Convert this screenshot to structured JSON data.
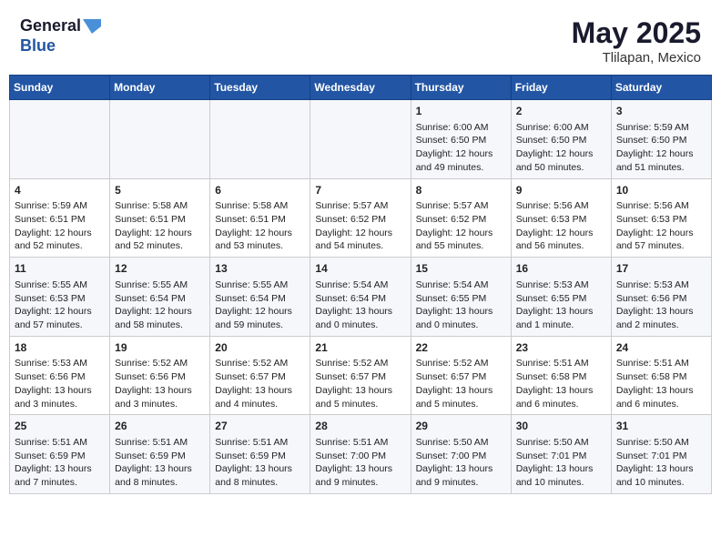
{
  "logo": {
    "line1": "General",
    "line2": "Blue"
  },
  "title": "May 2025",
  "location": "Tlilapan, Mexico",
  "weekdays": [
    "Sunday",
    "Monday",
    "Tuesday",
    "Wednesday",
    "Thursday",
    "Friday",
    "Saturday"
  ],
  "weeks": [
    [
      {
        "day": "",
        "info": ""
      },
      {
        "day": "",
        "info": ""
      },
      {
        "day": "",
        "info": ""
      },
      {
        "day": "",
        "info": ""
      },
      {
        "day": "1",
        "info": "Sunrise: 6:00 AM\nSunset: 6:50 PM\nDaylight: 12 hours\nand 49 minutes."
      },
      {
        "day": "2",
        "info": "Sunrise: 6:00 AM\nSunset: 6:50 PM\nDaylight: 12 hours\nand 50 minutes."
      },
      {
        "day": "3",
        "info": "Sunrise: 5:59 AM\nSunset: 6:50 PM\nDaylight: 12 hours\nand 51 minutes."
      }
    ],
    [
      {
        "day": "4",
        "info": "Sunrise: 5:59 AM\nSunset: 6:51 PM\nDaylight: 12 hours\nand 52 minutes."
      },
      {
        "day": "5",
        "info": "Sunrise: 5:58 AM\nSunset: 6:51 PM\nDaylight: 12 hours\nand 52 minutes."
      },
      {
        "day": "6",
        "info": "Sunrise: 5:58 AM\nSunset: 6:51 PM\nDaylight: 12 hours\nand 53 minutes."
      },
      {
        "day": "7",
        "info": "Sunrise: 5:57 AM\nSunset: 6:52 PM\nDaylight: 12 hours\nand 54 minutes."
      },
      {
        "day": "8",
        "info": "Sunrise: 5:57 AM\nSunset: 6:52 PM\nDaylight: 12 hours\nand 55 minutes."
      },
      {
        "day": "9",
        "info": "Sunrise: 5:56 AM\nSunset: 6:53 PM\nDaylight: 12 hours\nand 56 minutes."
      },
      {
        "day": "10",
        "info": "Sunrise: 5:56 AM\nSunset: 6:53 PM\nDaylight: 12 hours\nand 57 minutes."
      }
    ],
    [
      {
        "day": "11",
        "info": "Sunrise: 5:55 AM\nSunset: 6:53 PM\nDaylight: 12 hours\nand 57 minutes."
      },
      {
        "day": "12",
        "info": "Sunrise: 5:55 AM\nSunset: 6:54 PM\nDaylight: 12 hours\nand 58 minutes."
      },
      {
        "day": "13",
        "info": "Sunrise: 5:55 AM\nSunset: 6:54 PM\nDaylight: 12 hours\nand 59 minutes."
      },
      {
        "day": "14",
        "info": "Sunrise: 5:54 AM\nSunset: 6:54 PM\nDaylight: 13 hours\nand 0 minutes."
      },
      {
        "day": "15",
        "info": "Sunrise: 5:54 AM\nSunset: 6:55 PM\nDaylight: 13 hours\nand 0 minutes."
      },
      {
        "day": "16",
        "info": "Sunrise: 5:53 AM\nSunset: 6:55 PM\nDaylight: 13 hours\nand 1 minute."
      },
      {
        "day": "17",
        "info": "Sunrise: 5:53 AM\nSunset: 6:56 PM\nDaylight: 13 hours\nand 2 minutes."
      }
    ],
    [
      {
        "day": "18",
        "info": "Sunrise: 5:53 AM\nSunset: 6:56 PM\nDaylight: 13 hours\nand 3 minutes."
      },
      {
        "day": "19",
        "info": "Sunrise: 5:52 AM\nSunset: 6:56 PM\nDaylight: 13 hours\nand 3 minutes."
      },
      {
        "day": "20",
        "info": "Sunrise: 5:52 AM\nSunset: 6:57 PM\nDaylight: 13 hours\nand 4 minutes."
      },
      {
        "day": "21",
        "info": "Sunrise: 5:52 AM\nSunset: 6:57 PM\nDaylight: 13 hours\nand 5 minutes."
      },
      {
        "day": "22",
        "info": "Sunrise: 5:52 AM\nSunset: 6:57 PM\nDaylight: 13 hours\nand 5 minutes."
      },
      {
        "day": "23",
        "info": "Sunrise: 5:51 AM\nSunset: 6:58 PM\nDaylight: 13 hours\nand 6 minutes."
      },
      {
        "day": "24",
        "info": "Sunrise: 5:51 AM\nSunset: 6:58 PM\nDaylight: 13 hours\nand 6 minutes."
      }
    ],
    [
      {
        "day": "25",
        "info": "Sunrise: 5:51 AM\nSunset: 6:59 PM\nDaylight: 13 hours\nand 7 minutes."
      },
      {
        "day": "26",
        "info": "Sunrise: 5:51 AM\nSunset: 6:59 PM\nDaylight: 13 hours\nand 8 minutes."
      },
      {
        "day": "27",
        "info": "Sunrise: 5:51 AM\nSunset: 6:59 PM\nDaylight: 13 hours\nand 8 minutes."
      },
      {
        "day": "28",
        "info": "Sunrise: 5:51 AM\nSunset: 7:00 PM\nDaylight: 13 hours\nand 9 minutes."
      },
      {
        "day": "29",
        "info": "Sunrise: 5:50 AM\nSunset: 7:00 PM\nDaylight: 13 hours\nand 9 minutes."
      },
      {
        "day": "30",
        "info": "Sunrise: 5:50 AM\nSunset: 7:01 PM\nDaylight: 13 hours\nand 10 minutes."
      },
      {
        "day": "31",
        "info": "Sunrise: 5:50 AM\nSunset: 7:01 PM\nDaylight: 13 hours\nand 10 minutes."
      }
    ]
  ]
}
